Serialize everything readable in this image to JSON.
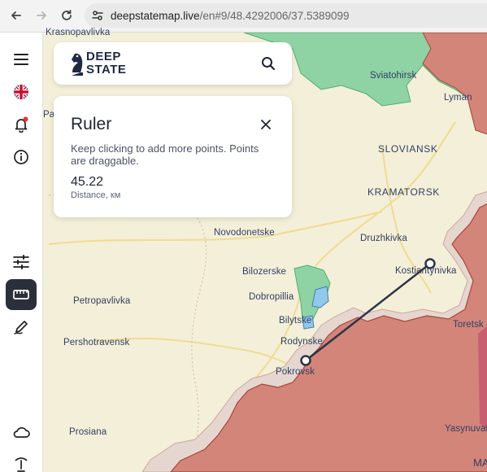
{
  "browser": {
    "url_host": "deepstatemap.live",
    "url_path": "/en#9/48.4292006/37.5389099"
  },
  "app": {
    "logo_line1": "DEEP",
    "logo_line2": "STATE"
  },
  "ruler": {
    "title": "Ruler",
    "hint": "Keep clicking to add more points. Points are draggable.",
    "distance_value": "45.22",
    "distance_label": "Distance, км"
  },
  "map": {
    "places": {
      "krasnopavlivka": "Krasnopavlivka",
      "sviatohirsk": "Sviatohirsk",
      "lyman": "Lyman",
      "pa": "Pa",
      "sloviansk": "SLOVIANSK",
      "kramatorsk": "KRAMATORSK",
      "novodonetske": "Novodonetske",
      "druzhkivka": "Druzhkivka",
      "bilozerske": "Bilozerske",
      "kostiantynivka": "Kostiantynivka",
      "petropavlivka": "Petropavlivka",
      "dobropillia": "Dobropillia",
      "bilytske": "Bilytske",
      "toretsk": "Toretsk",
      "pershotravensk": "Pershotravensk",
      "rodynske": "Rodynske",
      "pokrovsk": "Pokrovsk",
      "prosiana": "Prosiana",
      "yasynuvata": "Yasynuvat",
      "ma": "MA"
    }
  },
  "colors": {
    "map_bg": "#f4efd9",
    "occupied": "#d3857a",
    "liberated": "#8fd3a4",
    "contested_blue": "#93c8ea",
    "grey_zone": "#e5d7cf",
    "ruler_line": "#2e3446"
  }
}
